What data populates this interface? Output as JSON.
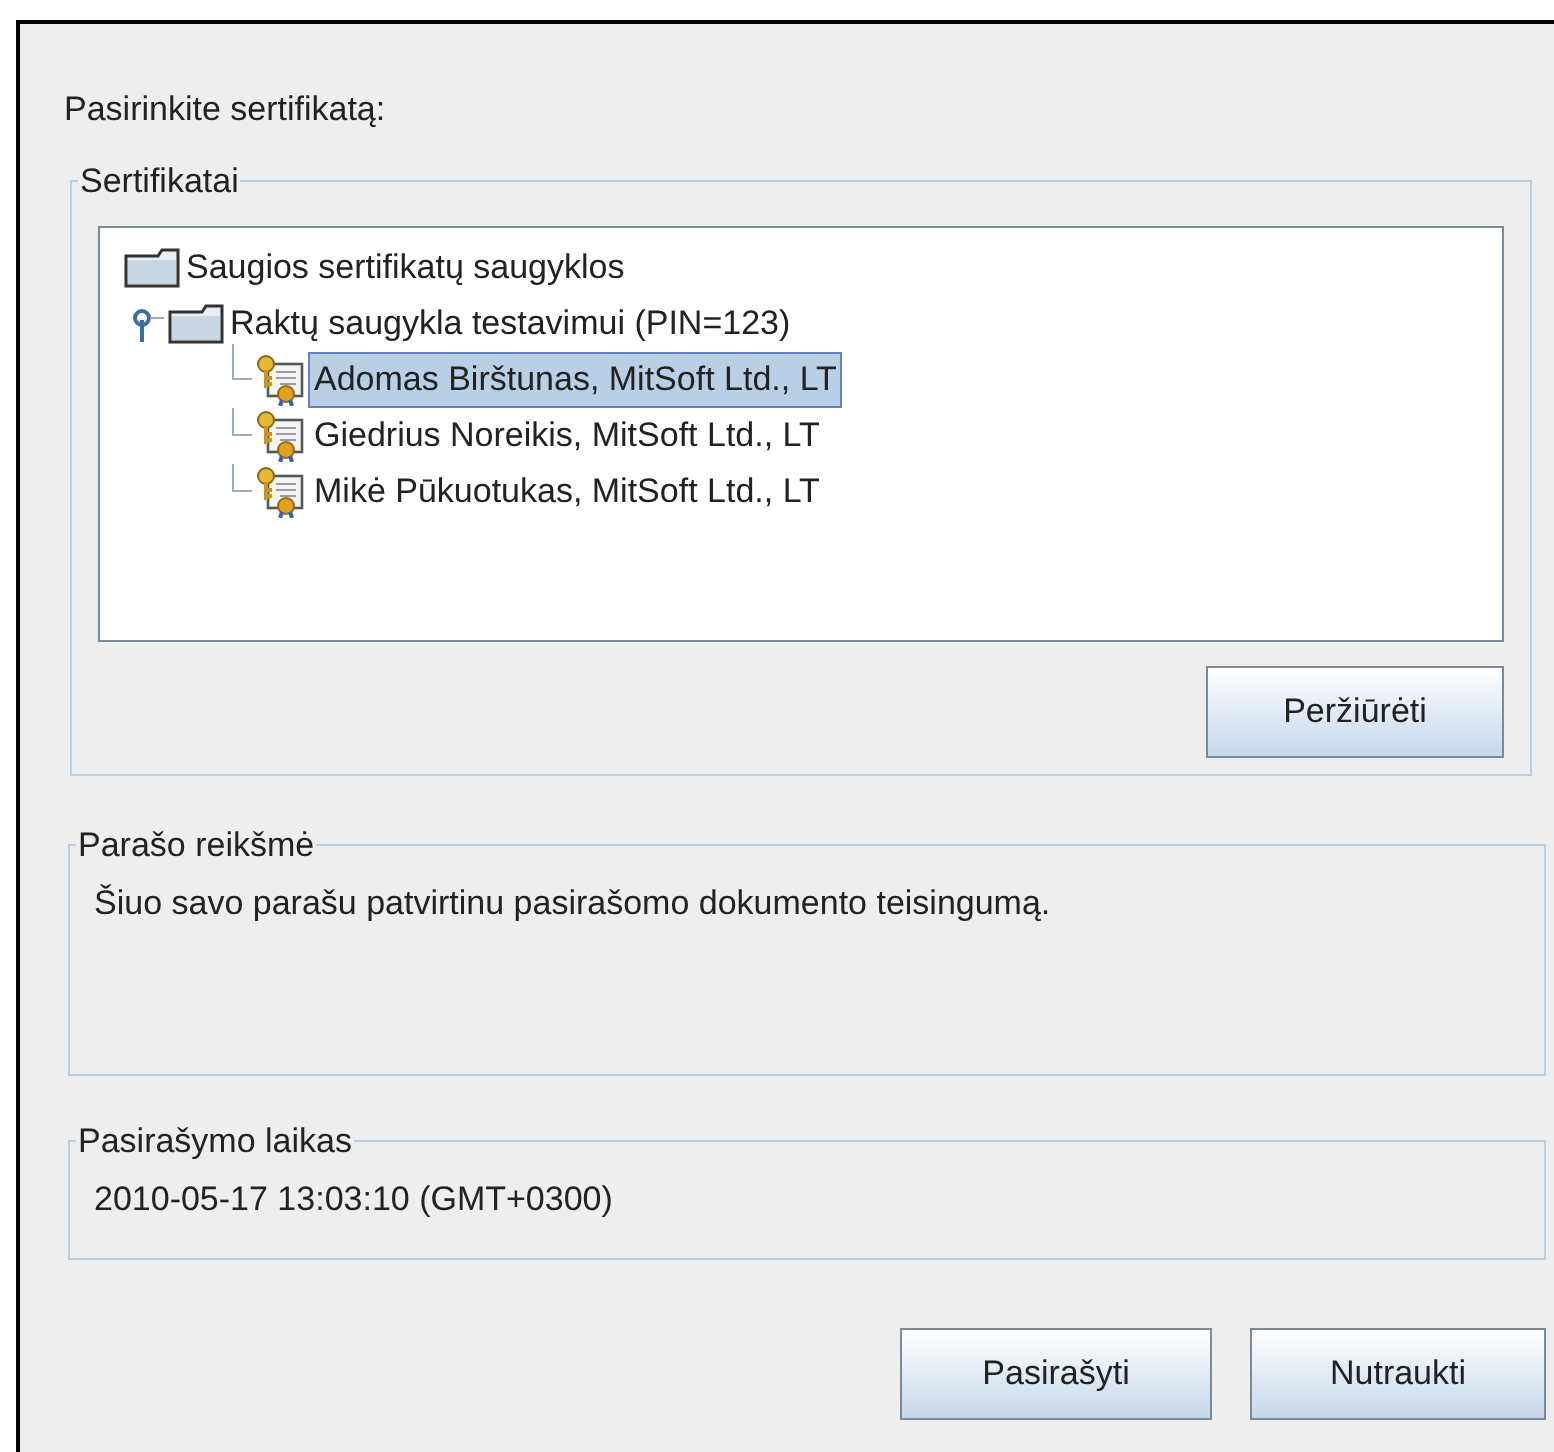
{
  "prompt": "Pasirinkite sertifikatą:",
  "certificates_group": {
    "title": "Sertifikatai",
    "tree": [
      {
        "label": "Saugios sertifikatų saugyklos",
        "kind": "folder",
        "children": [
          {
            "label": "Raktų saugykla testavimui (PIN=123)",
            "kind": "folder",
            "expanded": true,
            "children": [
              {
                "label": "Adomas Birštunas, MitSoft Ltd., LT",
                "kind": "certificate",
                "selected": true
              },
              {
                "label": "Giedrius Noreikis, MitSoft Ltd., LT",
                "kind": "certificate",
                "selected": false
              },
              {
                "label": "Mikė Pūkuotukas, MitSoft Ltd., LT",
                "kind": "certificate",
                "selected": false
              }
            ]
          }
        ]
      }
    ],
    "view_button": "Peržiūrėti"
  },
  "signature_meaning": {
    "title": "Parašo reikšmė",
    "text": "Šiuo savo parašu patvirtinu pasirašomo dokumento teisingumą."
  },
  "signing_time": {
    "title": "Pasirašymo laikas",
    "text": "2010-05-17 13:03:10 (GMT+0300)"
  },
  "buttons": [
    "Pasirašyti",
    "Nutraukti"
  ]
}
